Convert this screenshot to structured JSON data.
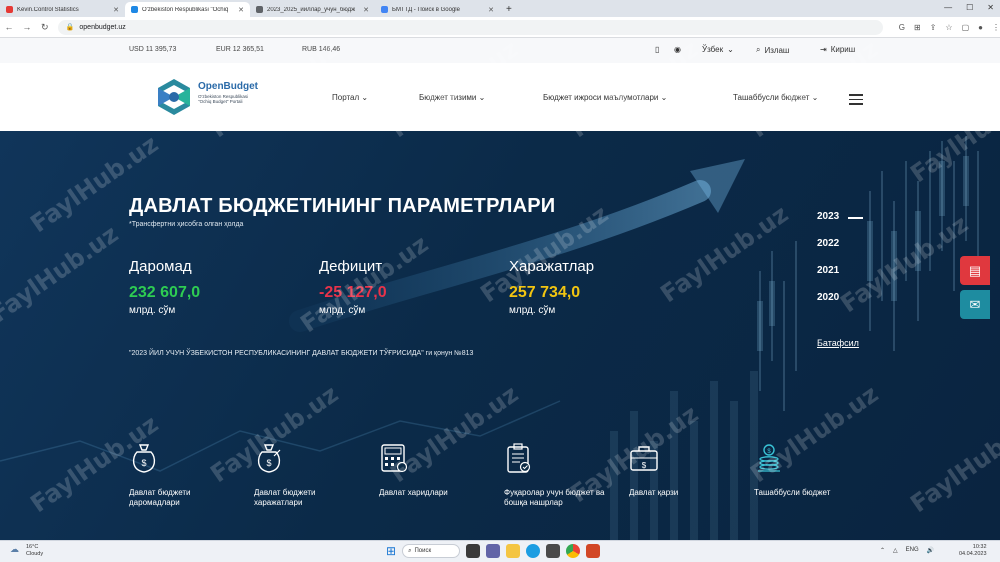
{
  "browser": {
    "tabs": [
      {
        "title": "Kevin.Control Statistics",
        "color": "#e53935",
        "active": false
      },
      {
        "title": "O'zbekiston Respublikasi \"Ochiq",
        "color": "#1e88e5",
        "active": true
      },
      {
        "title": "2023_2025_йиллар_учун_бюдж",
        "color": "#5f6368",
        "active": false
      },
      {
        "title": "БМТТД - Поиск в Google",
        "color": "#4285f4",
        "active": false
      }
    ],
    "url": "openbudget.uz",
    "new_tab": "+"
  },
  "topbar": {
    "rates": [
      "USD 11 395,73",
      "EUR 12 365,51",
      "RUB 146,46"
    ],
    "language": "Ўзбек",
    "search_label": "Излаш",
    "login_label": "Кириш"
  },
  "header": {
    "logo_title": "OpenBudget",
    "logo_sub": "O'zbekiston Respublikasi \"Ochiq Budget\" Portali",
    "nav": [
      "Портал",
      "Бюджет тизими",
      "Бюджет ижроси маълумотлари",
      "Ташаббусли бюджет"
    ]
  },
  "hero": {
    "title": "ДАВЛАТ БЮДЖЕТИНИНГ ПАРАМЕТРЛАРИ",
    "subtitle": "*Трансфертни ҳисобга олган ҳолда",
    "stats": [
      {
        "label": "Даромад",
        "value": "232 607,0",
        "unit": "млрд. сўм",
        "color": "#2ecc52"
      },
      {
        "label": "Дефицит",
        "value": "-25 127,0",
        "unit": "млрд. сўм",
        "color": "#e8334a"
      },
      {
        "label": "Харажатлар",
        "value": "257 734,0",
        "unit": "млрд. сўм",
        "color": "#f2c511"
      }
    ],
    "law": "\"2023 ЙИЛ УЧУН ЎЗБЕКИСТОН РЕСПУБЛИКАСИНИНГ ДАВЛАТ БЮДЖЕТИ ТЎҒРИСИДА\" ги қонун №813",
    "years": [
      "2023",
      "2022",
      "2021",
      "2020"
    ],
    "active_year": "2023",
    "more": "Батафсил",
    "categories": [
      {
        "label": "Давлат бюджети даромадлари",
        "icon": "money-bag-icon"
      },
      {
        "label": "Давлат бюджети харажатлари",
        "icon": "money-bag-out-icon"
      },
      {
        "label": "Давлат харидлари",
        "icon": "calculator-icon"
      },
      {
        "label": "Фуқаролар учун бюджет ва бошқа нашрлар",
        "icon": "clipboard-icon"
      },
      {
        "label": "Давлат қарзи",
        "icon": "briefcase-icon"
      },
      {
        "label": "Ташаббусли бюджет",
        "icon": "coins-icon"
      }
    ]
  },
  "watermark": "FaylHub.uz",
  "taskbar": {
    "temp": "16°C",
    "weather": "Cloudy",
    "search": "Поиск",
    "lang": "ENG",
    "time": "10:32",
    "date": "04.04.2023"
  }
}
